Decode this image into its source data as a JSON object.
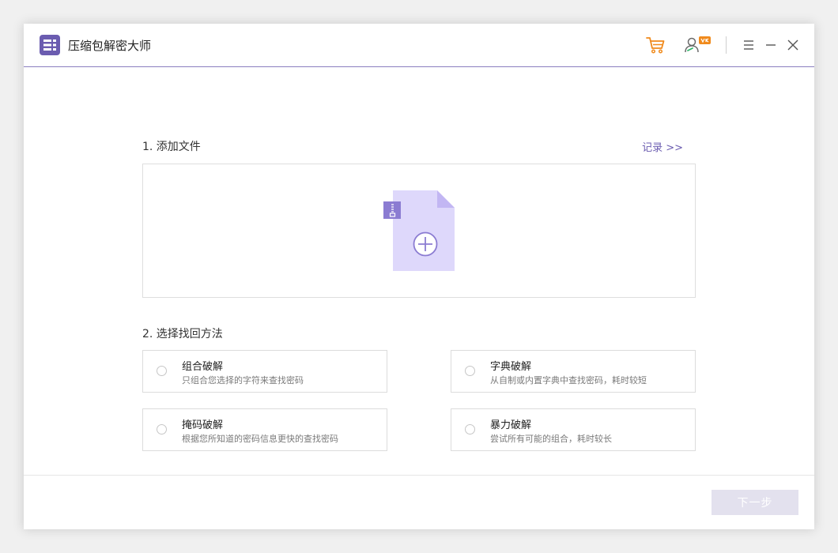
{
  "app": {
    "title": "压缩包解密大师",
    "accent_color": "#6b5cb0",
    "cart_color": "#f08a1c"
  },
  "titlebar": {
    "icons": [
      "cart-icon",
      "user-vip-icon",
      "menu-icon",
      "minimize-icon",
      "close-icon"
    ]
  },
  "step1": {
    "label": "1. 添加文件",
    "records_link": "记录 >>",
    "dropzone_icon": "zip-file-add-icon"
  },
  "step2": {
    "label": "2. 选择找回方法",
    "options": [
      {
        "title": "组合破解",
        "desc": "只组合您选择的字符来查找密码"
      },
      {
        "title": "字典破解",
        "desc": "从自制或内置字典中查找密码，耗时较短"
      },
      {
        "title": "掩码破解",
        "desc": "根据您所知道的密码信息更快的查找密码"
      },
      {
        "title": "暴力破解",
        "desc": "尝试所有可能的组合，耗时较长"
      }
    ]
  },
  "footer": {
    "next_label": "下一步"
  }
}
